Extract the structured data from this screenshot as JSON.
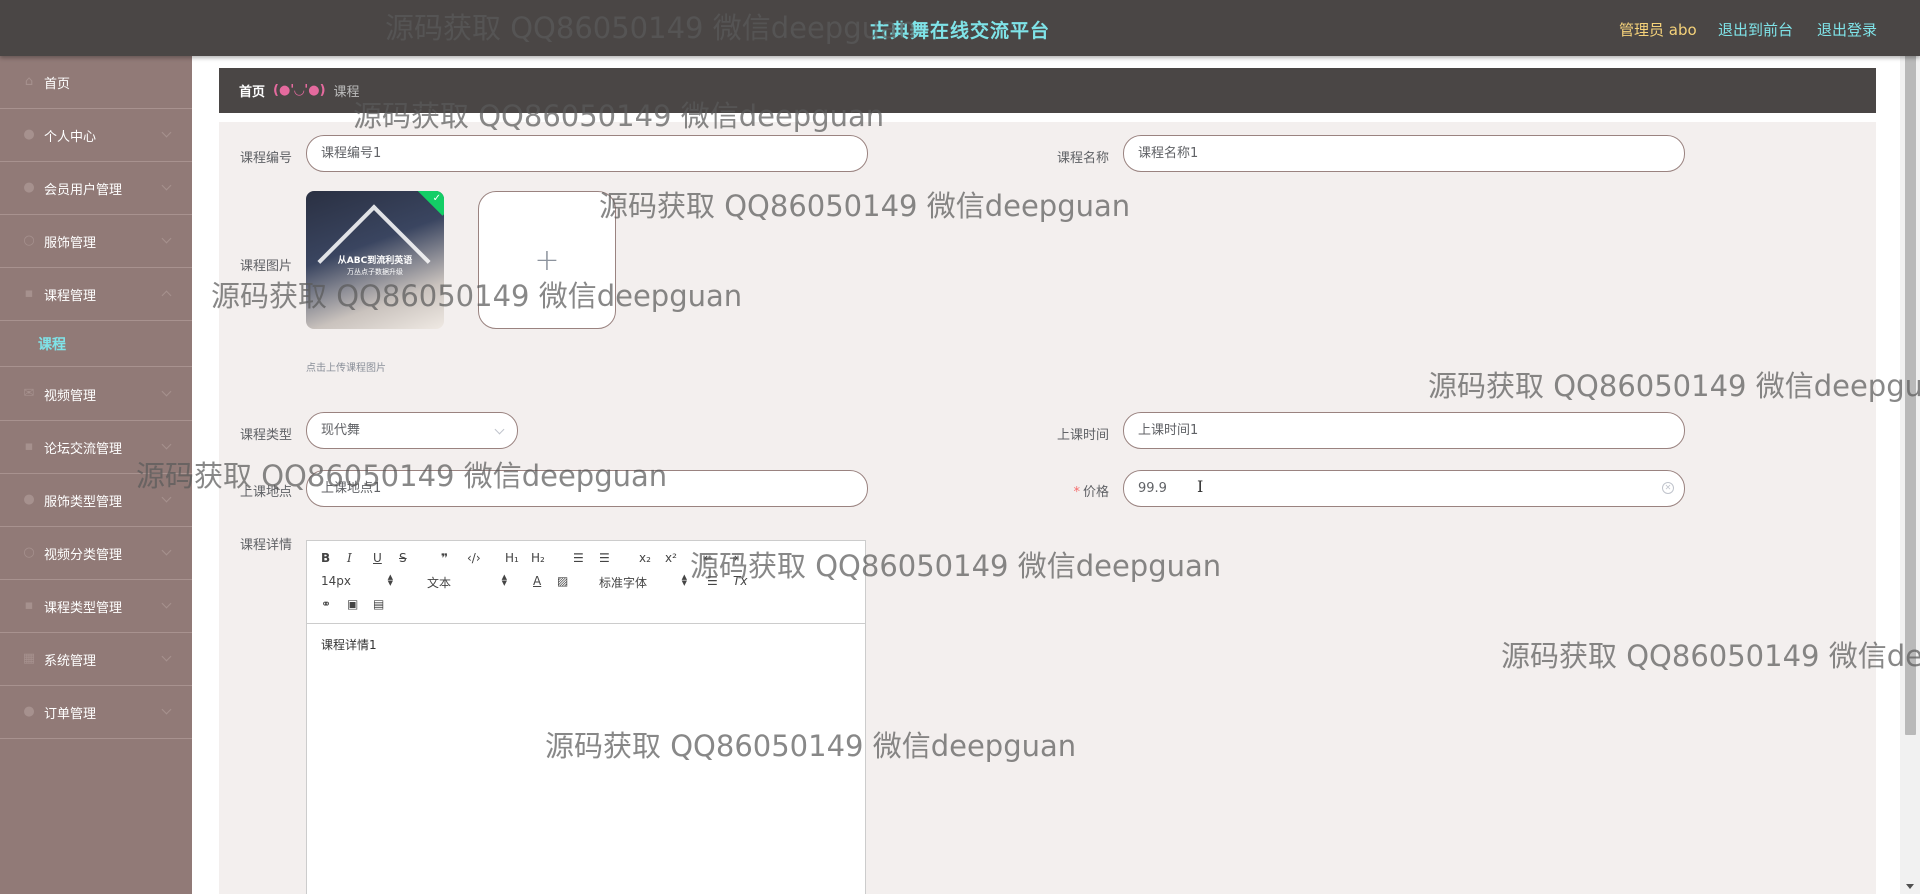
{
  "header": {
    "title": "古典舞在线交流平台",
    "user_label": "管理员 abo",
    "back_to_front": "退出到前台",
    "logout": "退出登录"
  },
  "sidebar": {
    "items": [
      {
        "label": "首页",
        "icon": "home-icon"
      },
      {
        "label": "个人中心",
        "icon": "user-icon"
      },
      {
        "label": "会员用户管理",
        "icon": "users-icon"
      },
      {
        "label": "服饰管理",
        "icon": "clothing-icon"
      },
      {
        "label": "课程管理",
        "icon": "course-icon"
      },
      {
        "label": "视频管理",
        "icon": "video-icon"
      },
      {
        "label": "论坛交流管理",
        "icon": "forum-icon"
      },
      {
        "label": "服饰类型管理",
        "icon": "category-icon"
      },
      {
        "label": "视频分类管理",
        "icon": "category-icon"
      },
      {
        "label": "课程类型管理",
        "icon": "category-icon"
      },
      {
        "label": "系统管理",
        "icon": "settings-icon"
      },
      {
        "label": "订单管理",
        "icon": "order-icon"
      }
    ],
    "submenu": {
      "label": "课程"
    }
  },
  "breadcrumb": {
    "home": "首页",
    "separator": "(●'◡'●)",
    "current": "课程"
  },
  "form": {
    "course_no": {
      "label": "课程编号",
      "value": "课程编号1"
    },
    "course_name": {
      "label": "课程名称",
      "value": "课程名称1"
    },
    "course_image": {
      "label": "课程图片",
      "thumb_text": "从ABC到流利英语",
      "thumb_subtext": "万丛点子数据升级",
      "tip": "点击上传课程图片",
      "add_symbol": "+"
    },
    "course_type": {
      "label": "课程类型",
      "value": "现代舞"
    },
    "class_time": {
      "label": "上课时间",
      "value": "上课时间1"
    },
    "class_location": {
      "label": "上课地点",
      "value": "上课地点1"
    },
    "price": {
      "label": "价格",
      "required": "*",
      "value": "99.9"
    },
    "course_detail": {
      "label": "课程详情",
      "editor": {
        "font_size": "14px",
        "paragraph": "文本",
        "font_family": "标准字体",
        "content": "课程详情1"
      }
    }
  },
  "watermark_text": "源码获取 QQ86050149 微信deepguan"
}
